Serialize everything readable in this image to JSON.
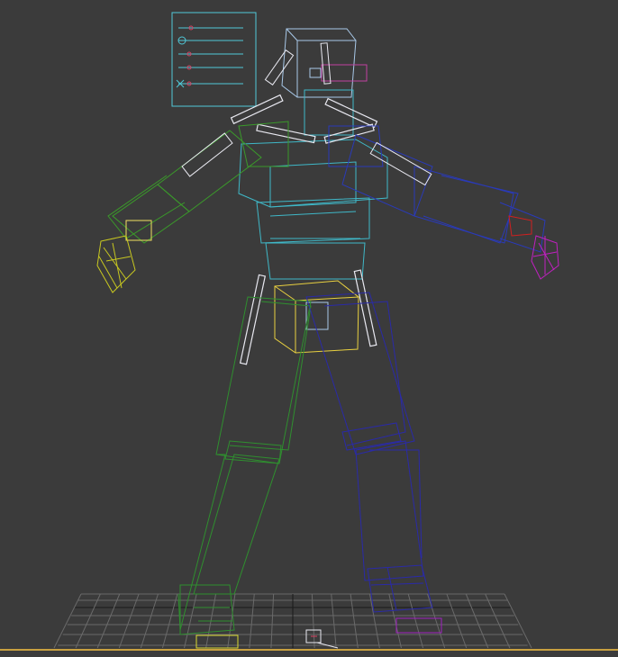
{
  "viewport": {
    "background": "#3b3b3b",
    "grid_color": "#6a6a6a",
    "grid_axis_color": "#1a1a1a"
  },
  "colors": {
    "spine": "#3fb8c8",
    "left_arm": "#3a9a2a",
    "right_arm": "#2a3ab8",
    "left_leg": "#2f8f2f",
    "right_leg": "#2a2aa8",
    "head": "#a8c8e8",
    "pelvis_ctrl": "#e8d040",
    "hand_left": "#c8c820",
    "hand_right": "#c020c0",
    "eye_ctrl": "#c040a0",
    "bone": "#e8e8f0",
    "panel": "#50c8d8",
    "foot_ctrl_left": "#d8d830",
    "foot_ctrl_right": "#a020c0"
  },
  "icons": {
    "control_panel": "slider-panel-icon",
    "ground_grid": "grid-plane-icon",
    "root_marker": "root-helper-icon"
  }
}
